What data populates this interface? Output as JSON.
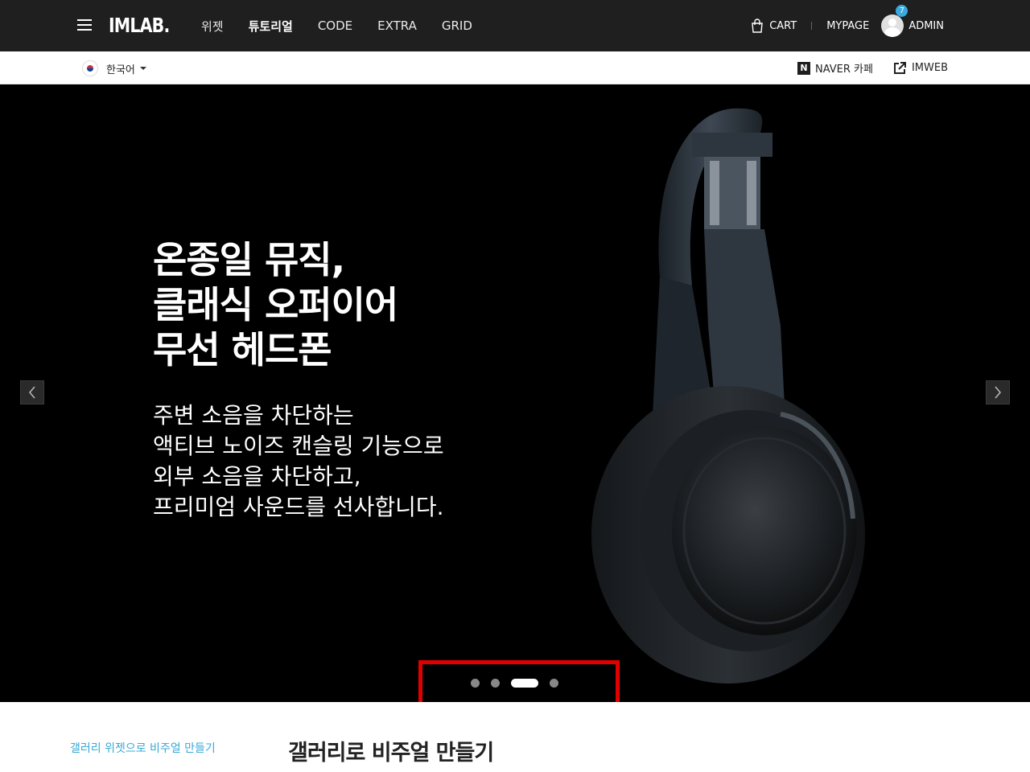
{
  "header": {
    "logo": "IMLAB.",
    "nav": [
      "위젯",
      "튜토리얼",
      "CODE",
      "EXTRA",
      "GRID"
    ],
    "active_nav": "튜토리얼",
    "cart_label": "CART",
    "mypage_label": "MYPAGE",
    "admin_label": "ADMIN",
    "notification_count": "7"
  },
  "subbar": {
    "language": "한국어",
    "naver_label": "NAVER 카페",
    "naver_icon": "N",
    "imweb_label": "IMWEB"
  },
  "hero": {
    "title": "온종일 뮤직,\n클래식 오퍼이어\n무선 헤드폰",
    "description": "주변 소음을 차단하는\n액티브 노이즈 캔슬링 기능으로\n외부 소음을 차단하고,\n프리미엄 사운드를 선사합니다.",
    "slide_count": 4,
    "active_slide": 3,
    "highlight_color": "#e00000"
  },
  "section": {
    "kicker": "갤러리 위젯으로 비주얼 만들기",
    "title": "갤러리로 비주얼 만들기"
  },
  "colors": {
    "topbar_bg": "#1f1f1f",
    "accent": "#39a9d6"
  }
}
